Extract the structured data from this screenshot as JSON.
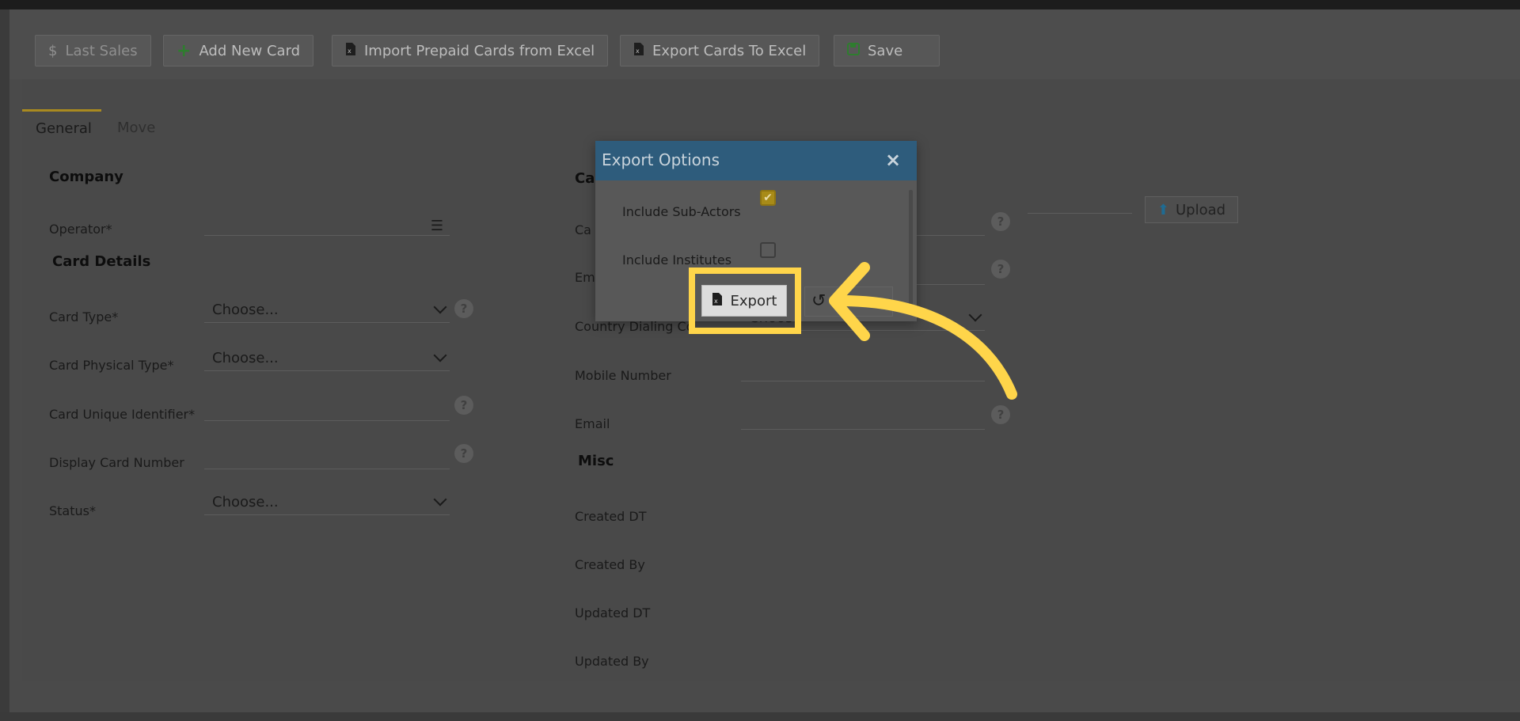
{
  "toolbar": {
    "buttons": [
      {
        "label": "Last Sales",
        "icon": "dollar-icon"
      },
      {
        "label": "Add New Card",
        "icon": "plus-icon"
      },
      {
        "label": "Import Prepaid Cards from Excel",
        "icon": "excel-file-icon"
      },
      {
        "label": "Export Cards To Excel",
        "icon": "excel-file-icon"
      },
      {
        "label": "Save",
        "icon": "save-icon"
      }
    ]
  },
  "tabs": [
    {
      "label": "General",
      "active": true
    },
    {
      "label": "Move",
      "active": false
    }
  ],
  "left_form": {
    "company_title": "Company",
    "operator_label": "Operator*",
    "card_details_title": "Card Details",
    "card_type_label": "Card Type*",
    "card_type_value": "Choose...",
    "card_physical_type_label": "Card Physical Type*",
    "card_physical_type_value": "Choose...",
    "card_unique_identifier_label": "Card Unique Identifier*",
    "display_card_number_label": "Display Card Number",
    "status_label": "Status*",
    "status_value": "Choose..."
  },
  "right_form": {
    "section_title_partial": "Ca",
    "row1_label_partial": "Ca",
    "row2_label_partial": "Em",
    "country_dialing_label_partial": "Country Dialing Co",
    "country_dialing_value_partial": "Choos",
    "mobile_number_label": "Mobile Number",
    "email_label": "Email",
    "misc_title": "Misc",
    "created_dt_label": "Created DT",
    "created_by_label": "Created By",
    "updated_dt_label": "Updated DT",
    "updated_by_label": "Updated By",
    "upload_label": "Upload"
  },
  "modal": {
    "title": "Export Options",
    "close_glyph": "×",
    "include_sub_actors_label": "Include Sub-Actors",
    "include_sub_actors_checked": true,
    "include_institutes_label": "Include Institutes",
    "include_institutes_checked": false,
    "export_label": "Export",
    "reset_glyph": "↺"
  },
  "highlight_color": "#ffd54a",
  "modal_header_color": "#2e5c7c"
}
